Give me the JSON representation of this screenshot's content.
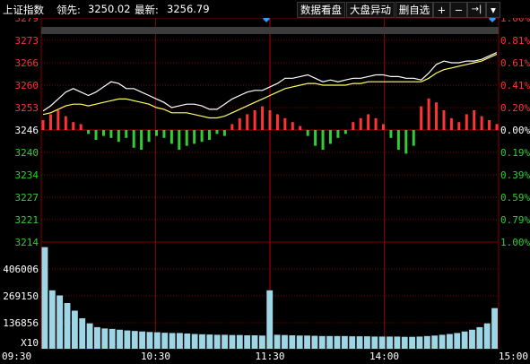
{
  "header": {
    "index_name": "上证指数",
    "leader_label": "领先:",
    "leader_value": "3250.02",
    "latest_label": "最新:",
    "latest_value": "3256.79",
    "buttons": [
      {
        "name": "data-view-button",
        "label": "数据看盘"
      },
      {
        "name": "market-alert-button",
        "label": "大盘异动"
      },
      {
        "name": "delete-watchlist-button",
        "label": "删自选"
      }
    ],
    "icon_buttons": [
      {
        "name": "zoom-in-button",
        "icon": "plus-icon",
        "glyph": "+"
      },
      {
        "name": "zoom-out-button",
        "icon": "minus-icon",
        "glyph": "−"
      },
      {
        "name": "jump-end-button",
        "icon": "jump-to-end-icon",
        "glyph": "→|"
      },
      {
        "name": "dropdown-button",
        "icon": "chevron-down-icon",
        "glyph": "▾"
      }
    ]
  },
  "price_axis_left": [
    "3279",
    "3273",
    "3266",
    "3260",
    "3253",
    "3246",
    "3240",
    "3234",
    "3227",
    "3221",
    "3214"
  ],
  "pct_axis_right": [
    "1.00%",
    "0.81%",
    "0.61%",
    "0.41%",
    "0.20%",
    "0.00%",
    "0.19%",
    "0.39%",
    "0.59%",
    "0.79%",
    "1.00%"
  ],
  "volume_axis": [
    "406006",
    "269150",
    "136856"
  ],
  "volume_multiplier": "X10",
  "time_axis": [
    "09:30",
    "10:30",
    "11:30",
    "14:00",
    "15:00"
  ],
  "chart_data": {
    "type": "line",
    "series": [
      {
        "values": [
          3252,
          3253.5,
          3255.5,
          3257.5,
          3258.5,
          3257.5,
          3256.5,
          3257.5,
          3259,
          3260.5,
          3260,
          3258.5,
          3258.5,
          3257.5,
          3256.5,
          3255.5,
          3254.5,
          3253,
          3253.5,
          3254,
          3254,
          3253.5,
          3252.5,
          3252.5,
          3254,
          3255.5,
          3256.5,
          3257.5,
          3258,
          3258,
          3259,
          3260,
          3261.5,
          3261.5,
          3262,
          3262.5,
          3261.5,
          3260.5,
          3261,
          3260.5,
          3261,
          3261.5,
          3261.5,
          3262,
          3262.5,
          3262.5,
          3262,
          3262,
          3261.5,
          3261.5,
          3261,
          3263,
          3265.5,
          3266.5,
          3266,
          3266,
          3266.5,
          3266.5,
          3267,
          3268,
          3269
        ]
      },
      {
        "values": [
          3251,
          3251.5,
          3252.5,
          3253.5,
          3254,
          3254,
          3253.5,
          3254,
          3254.5,
          3255,
          3255.5,
          3255.5,
          3255,
          3254.5,
          3254,
          3253,
          3252.5,
          3251.5,
          3251.5,
          3251.5,
          3251,
          3250.5,
          3250,
          3250,
          3250.5,
          3251.5,
          3252.5,
          3253.5,
          3254.5,
          3255.5,
          3256.5,
          3257.5,
          3258.5,
          3259,
          3259.5,
          3260,
          3260,
          3259.5,
          3259.5,
          3259.5,
          3259.5,
          3260,
          3260,
          3260.5,
          3260.5,
          3260.5,
          3260.5,
          3260.5,
          3260.5,
          3260.5,
          3260.5,
          3261.5,
          3263,
          3264,
          3264.5,
          3265,
          3265.5,
          3266,
          3266.5,
          3267.5,
          3268.5
        ]
      }
    ],
    "breadth_bars": [
      5,
      8,
      10,
      7,
      4,
      3,
      -2,
      -5,
      -3,
      -4,
      -6,
      -4,
      -9,
      -10,
      -6,
      -3,
      -4,
      -7,
      -10,
      -8,
      -7,
      -6,
      -5,
      -2,
      -3,
      3,
      6,
      8,
      10,
      12,
      10,
      8,
      6,
      4,
      2,
      -3,
      -8,
      -10,
      -7,
      -4,
      -2,
      4,
      6,
      8,
      6,
      3,
      -4,
      -10,
      -12,
      -8,
      12,
      16,
      14,
      10,
      6,
      4,
      8,
      10,
      7,
      5,
      3
    ],
    "volume": [
      400,
      230,
      210,
      180,
      150,
      120,
      100,
      85,
      80,
      78,
      75,
      72,
      70,
      68,
      66,
      65,
      63,
      62,
      62,
      60,
      58,
      57,
      56,
      55,
      55,
      54,
      54,
      53,
      53,
      52,
      230,
      55,
      54,
      53,
      52,
      52,
      51,
      50,
      50,
      50,
      50,
      49,
      49,
      49,
      48,
      48,
      48,
      48,
      47,
      47,
      48,
      50,
      52,
      55,
      58,
      62,
      68,
      75,
      85,
      100,
      160
    ],
    "ylim": [
      3214,
      3279
    ],
    "base_price": 3246
  },
  "colors": {
    "up": "#ff3333",
    "down": "#33cc33",
    "grid": "#800000",
    "price_line": "#ffffff",
    "avg_line": "#ffff66",
    "volume": "#9fd6e6",
    "marker": "#3399ff"
  }
}
